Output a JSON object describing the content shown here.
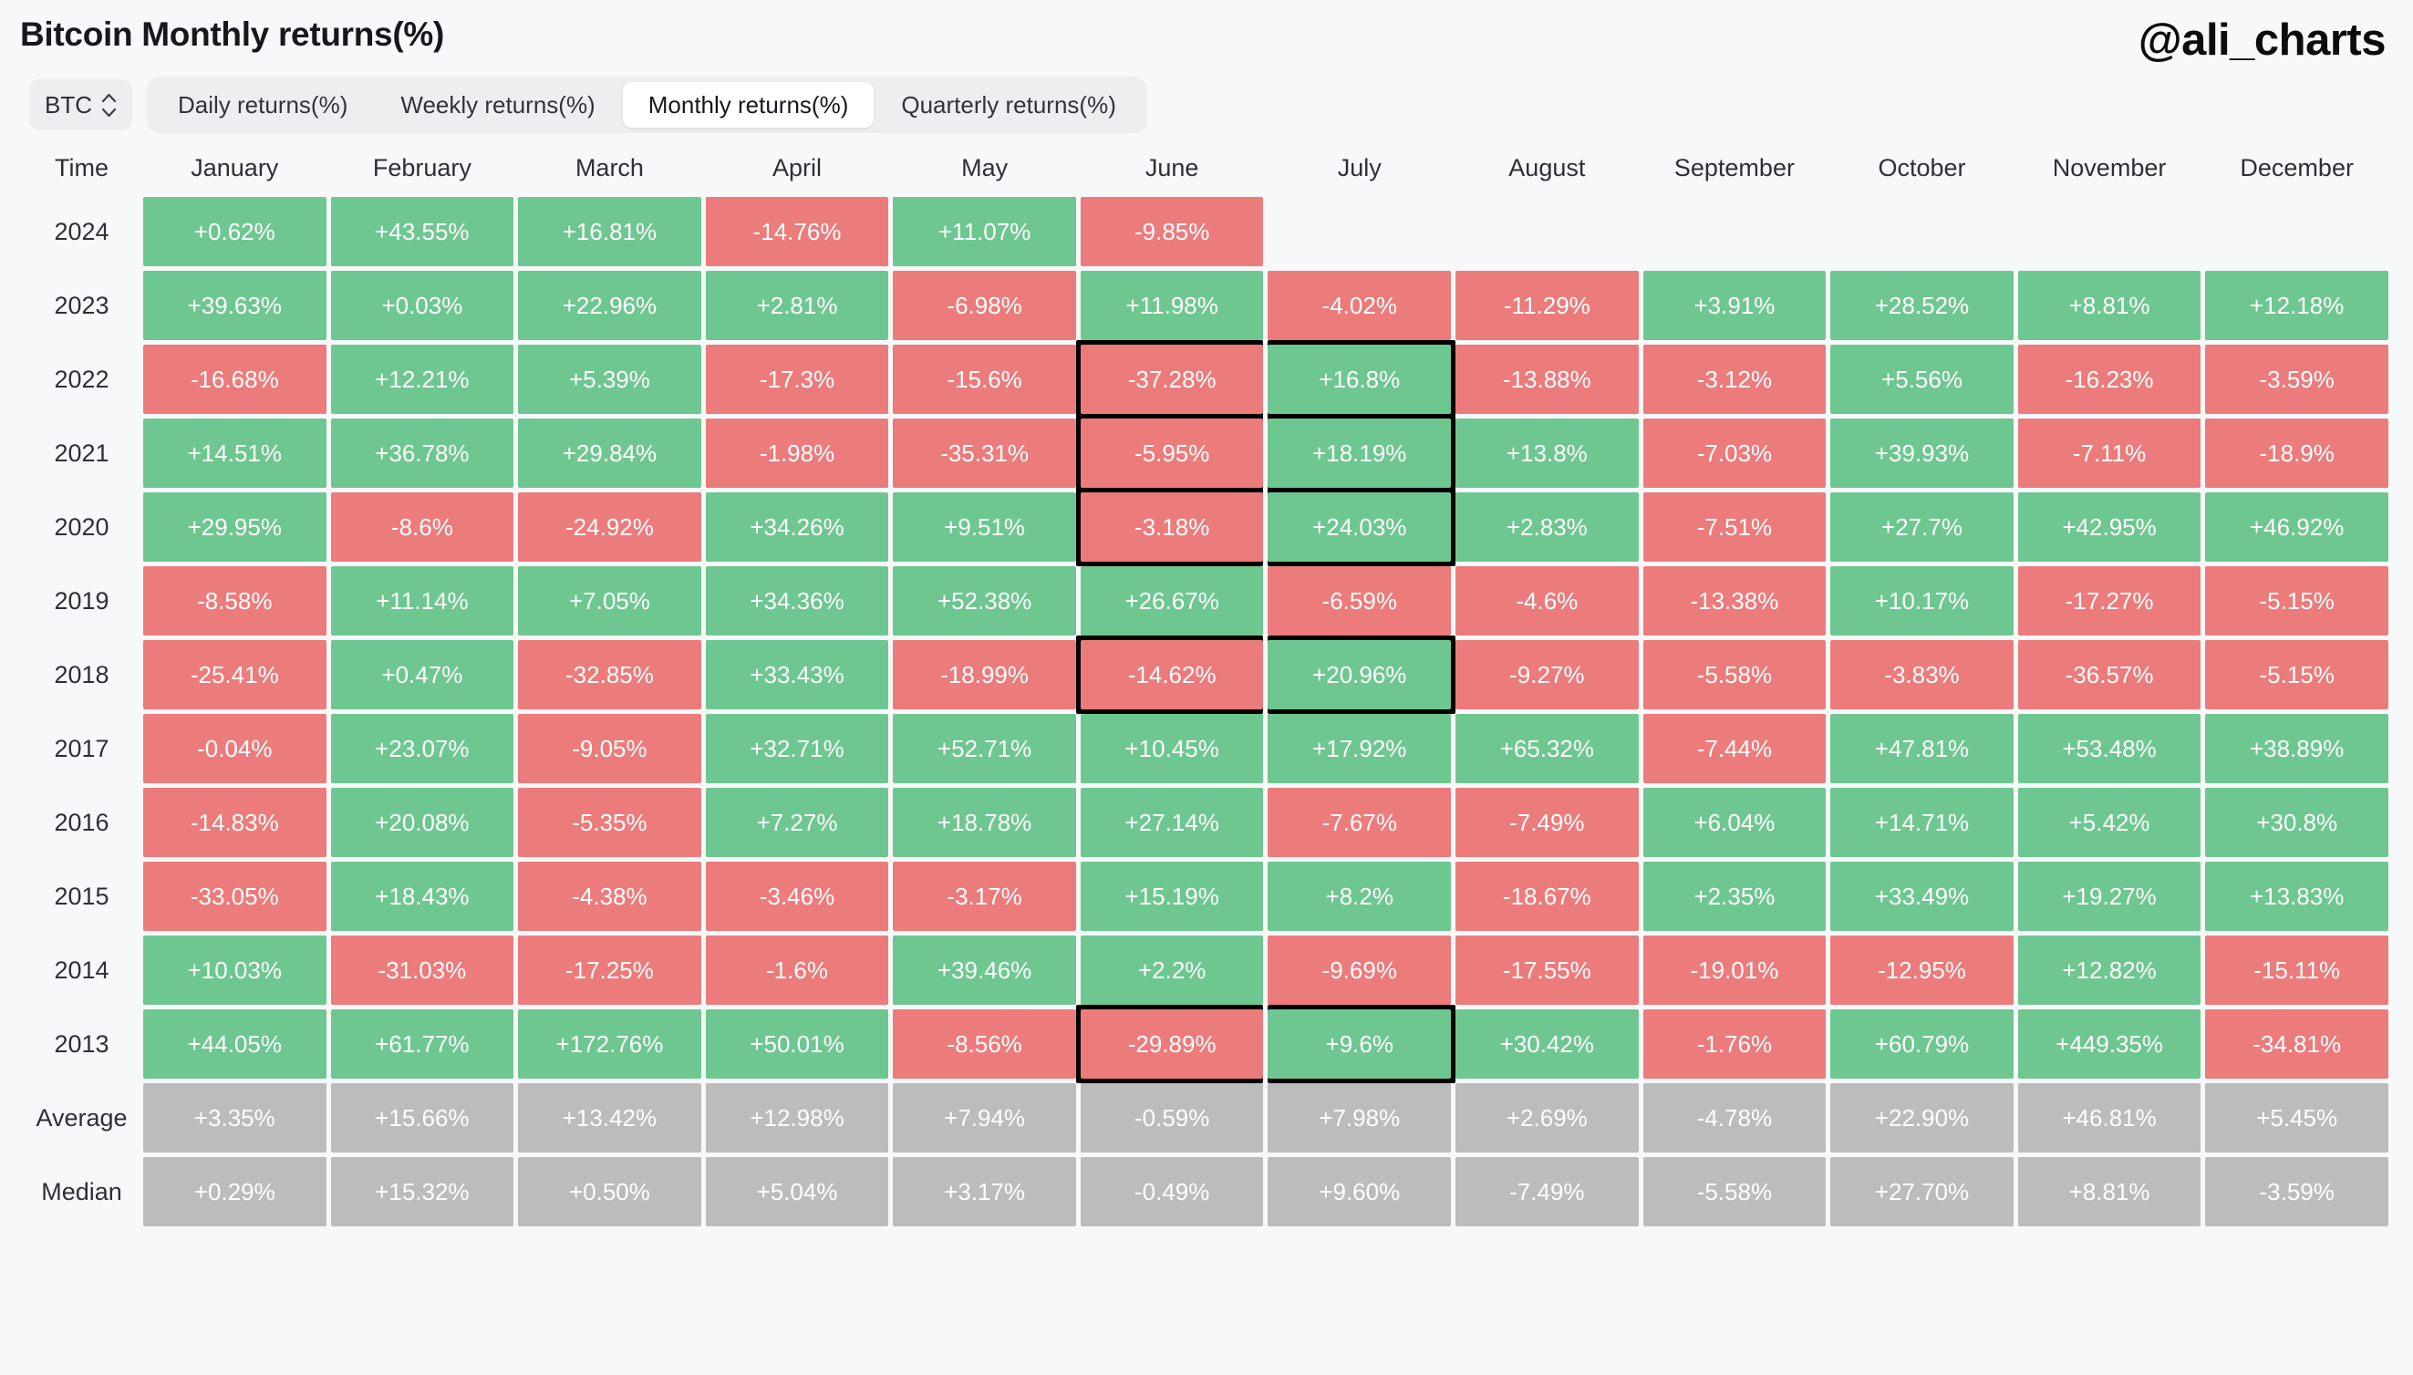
{
  "header": {
    "title": "Bitcoin Monthly returns(%)",
    "watermark": "@ali_charts"
  },
  "controls": {
    "symbol": "BTC",
    "symbol_icon": "up-down-stepper-icon",
    "tabs": [
      {
        "label": "Daily returns(%)",
        "active": false
      },
      {
        "label": "Weekly returns(%)",
        "active": false
      },
      {
        "label": "Monthly returns(%)",
        "active": true
      },
      {
        "label": "Quarterly returns(%)",
        "active": false
      }
    ]
  },
  "colors": {
    "positive": "#6ec790",
    "negative": "#ec7b7b",
    "summary": "#bcbcbc",
    "highlight_border": "#000000",
    "background": "#f7f8f9"
  },
  "chart_data": {
    "type": "heatmap",
    "title": "Bitcoin Monthly returns(%)",
    "xlabel": "",
    "ylabel": "Time",
    "columns": [
      "Time",
      "January",
      "February",
      "March",
      "April",
      "May",
      "June",
      "July",
      "August",
      "September",
      "October",
      "November",
      "December"
    ],
    "highlighted_cells": [
      {
        "row": "2022",
        "columns": [
          "June",
          "July"
        ]
      },
      {
        "row": "2021",
        "columns": [
          "June",
          "July"
        ]
      },
      {
        "row": "2020",
        "columns": [
          "June",
          "July"
        ]
      },
      {
        "row": "2018",
        "columns": [
          "June",
          "July"
        ]
      },
      {
        "row": "2013",
        "columns": [
          "June",
          "July"
        ]
      }
    ],
    "rows": [
      {
        "label": "2024",
        "type": "year",
        "values": [
          "+0.62%",
          "+43.55%",
          "+16.81%",
          "-14.76%",
          "+11.07%",
          "-9.85%",
          "",
          "",
          "",
          "",
          "",
          ""
        ]
      },
      {
        "label": "2023",
        "type": "year",
        "values": [
          "+39.63%",
          "+0.03%",
          "+22.96%",
          "+2.81%",
          "-6.98%",
          "+11.98%",
          "-4.02%",
          "-11.29%",
          "+3.91%",
          "+28.52%",
          "+8.81%",
          "+12.18%"
        ]
      },
      {
        "label": "2022",
        "type": "year",
        "values": [
          "-16.68%",
          "+12.21%",
          "+5.39%",
          "-17.3%",
          "-15.6%",
          "-37.28%",
          "+16.8%",
          "-13.88%",
          "-3.12%",
          "+5.56%",
          "-16.23%",
          "-3.59%"
        ]
      },
      {
        "label": "2021",
        "type": "year",
        "values": [
          "+14.51%",
          "+36.78%",
          "+29.84%",
          "-1.98%",
          "-35.31%",
          "-5.95%",
          "+18.19%",
          "+13.8%",
          "-7.03%",
          "+39.93%",
          "-7.11%",
          "-18.9%"
        ]
      },
      {
        "label": "2020",
        "type": "year",
        "values": [
          "+29.95%",
          "-8.6%",
          "-24.92%",
          "+34.26%",
          "+9.51%",
          "-3.18%",
          "+24.03%",
          "+2.83%",
          "-7.51%",
          "+27.7%",
          "+42.95%",
          "+46.92%"
        ]
      },
      {
        "label": "2019",
        "type": "year",
        "values": [
          "-8.58%",
          "+11.14%",
          "+7.05%",
          "+34.36%",
          "+52.38%",
          "+26.67%",
          "-6.59%",
          "-4.6%",
          "-13.38%",
          "+10.17%",
          "-17.27%",
          "-5.15%"
        ]
      },
      {
        "label": "2018",
        "type": "year",
        "values": [
          "-25.41%",
          "+0.47%",
          "-32.85%",
          "+33.43%",
          "-18.99%",
          "-14.62%",
          "+20.96%",
          "-9.27%",
          "-5.58%",
          "-3.83%",
          "-36.57%",
          "-5.15%"
        ]
      },
      {
        "label": "2017",
        "type": "year",
        "values": [
          "-0.04%",
          "+23.07%",
          "-9.05%",
          "+32.71%",
          "+52.71%",
          "+10.45%",
          "+17.92%",
          "+65.32%",
          "-7.44%",
          "+47.81%",
          "+53.48%",
          "+38.89%"
        ]
      },
      {
        "label": "2016",
        "type": "year",
        "values": [
          "-14.83%",
          "+20.08%",
          "-5.35%",
          "+7.27%",
          "+18.78%",
          "+27.14%",
          "-7.67%",
          "-7.49%",
          "+6.04%",
          "+14.71%",
          "+5.42%",
          "+30.8%"
        ]
      },
      {
        "label": "2015",
        "type": "year",
        "values": [
          "-33.05%",
          "+18.43%",
          "-4.38%",
          "-3.46%",
          "-3.17%",
          "+15.19%",
          "+8.2%",
          "-18.67%",
          "+2.35%",
          "+33.49%",
          "+19.27%",
          "+13.83%"
        ]
      },
      {
        "label": "2014",
        "type": "year",
        "values": [
          "+10.03%",
          "-31.03%",
          "-17.25%",
          "-1.6%",
          "+39.46%",
          "+2.2%",
          "-9.69%",
          "-17.55%",
          "-19.01%",
          "-12.95%",
          "+12.82%",
          "-15.11%"
        ]
      },
      {
        "label": "2013",
        "type": "year",
        "values": [
          "+44.05%",
          "+61.77%",
          "+172.76%",
          "+50.01%",
          "-8.56%",
          "-29.89%",
          "+9.6%",
          "+30.42%",
          "-1.76%",
          "+60.79%",
          "+449.35%",
          "-34.81%"
        ]
      },
      {
        "label": "Average",
        "type": "summary",
        "values": [
          "+3.35%",
          "+15.66%",
          "+13.42%",
          "+12.98%",
          "+7.94%",
          "-0.59%",
          "+7.98%",
          "+2.69%",
          "-4.78%",
          "+22.90%",
          "+46.81%",
          "+5.45%"
        ]
      },
      {
        "label": "Median",
        "type": "summary",
        "values": [
          "+0.29%",
          "+15.32%",
          "+0.50%",
          "+5.04%",
          "+3.17%",
          "-0.49%",
          "+9.60%",
          "-7.49%",
          "-5.58%",
          "+27.70%",
          "+8.81%",
          "-3.59%"
        ]
      }
    ]
  }
}
